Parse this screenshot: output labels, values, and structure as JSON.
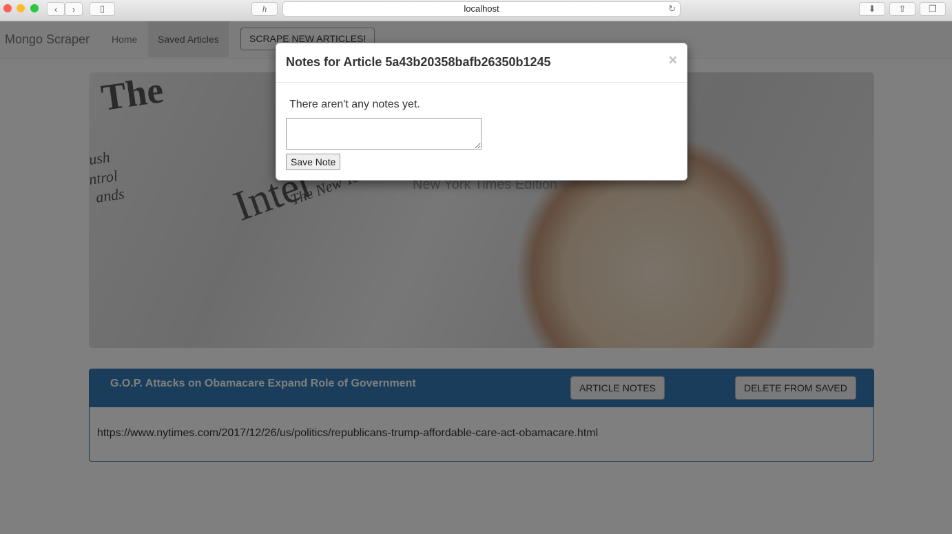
{
  "browser": {
    "url": "localhost",
    "icons": {
      "back": "chevron-left-icon",
      "forward": "chevron-right-icon",
      "sidebar": "sidebar-icon",
      "extension": "h-icon",
      "reload": "reload-icon",
      "download": "download-icon",
      "share": "share-icon",
      "tabs": "tabs-icon"
    }
  },
  "navbar": {
    "brand": "Mongo Scraper",
    "links": [
      "Home",
      "Saved Articles"
    ],
    "active_link": "Saved Articles",
    "scrape_button": "SCRAPE NEW ARTICLES!"
  },
  "hero": {
    "words": [
      "The",
      "Inter",
      "The New York",
      "ush",
      "ntrol",
      "ands"
    ],
    "subtitle": "New York Times Edition"
  },
  "article": {
    "title": "G.O.P. Attacks on Obamacare Expand Role of Government",
    "notes_button": "ARTICLE NOTES",
    "delete_button": "DELETE FROM SAVED",
    "link": "https://www.nytimes.com/2017/12/26/us/politics/republicans-trump-affordable-care-act-obamacare.html"
  },
  "modal": {
    "title": "Notes for Article 5a43b20358bafb26350b1245",
    "close": "×",
    "message": "There aren't any notes yet.",
    "note_value": "",
    "save_button": "Save Note"
  },
  "colors": {
    "panel_header": "#337ab7",
    "backdrop": "rgba(0,0,0,0.5)"
  }
}
